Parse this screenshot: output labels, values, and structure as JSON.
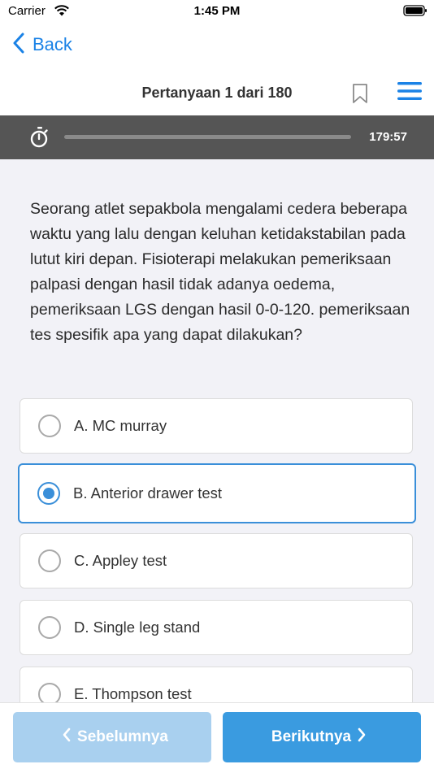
{
  "status_bar": {
    "carrier": "Carrier",
    "time": "1:45 PM"
  },
  "nav": {
    "back_label": "Back",
    "title": "Pertanyaan 1 dari 180"
  },
  "timer": {
    "remaining": "179:57",
    "progress_fraction": 0.0
  },
  "question": {
    "text": "Seorang atlet sepakbola mengalami cedera beberapa waktu yang lalu dengan keluhan ketidakstabilan pada lutut kiri depan. Fisioterapi melakukan pemeriksaan palpasi dengan hasil tidak adanya oedema, pemeriksaan LGS dengan hasil 0-0-120. pemeriksaan tes spesifik apa yang dapat dilakukan?"
  },
  "options": [
    {
      "label": "A. MC murray",
      "selected": false
    },
    {
      "label": "B. Anterior drawer test",
      "selected": true
    },
    {
      "label": "C. Appley test",
      "selected": false
    },
    {
      "label": "D. Single leg stand",
      "selected": false
    },
    {
      "label": "E. Thompson test",
      "selected": false
    }
  ],
  "footer": {
    "prev_label": "Sebelumnya",
    "next_label": "Berikutnya"
  },
  "colors": {
    "accent": "#1a82e6",
    "selected_border": "#3a8fd9",
    "timer_bg": "#555555",
    "next_bg": "#3a9be0",
    "prev_bg": "#a9d0ef"
  },
  "icons": [
    "wifi-icon",
    "battery-icon",
    "back-chevron-icon",
    "bookmark-icon",
    "menu-icon",
    "stopwatch-icon",
    "chevron-left-icon",
    "chevron-right-icon"
  ]
}
